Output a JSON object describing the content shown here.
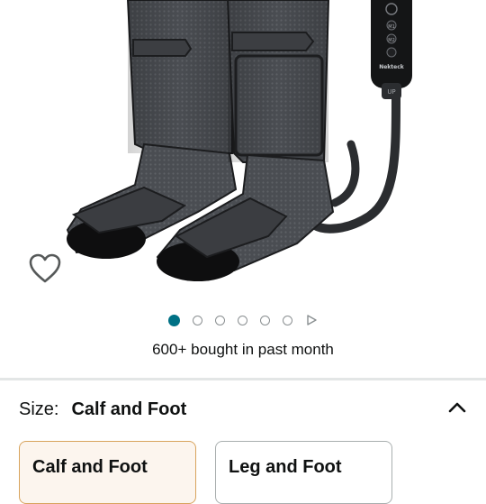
{
  "product": {
    "remote_brand": "Nekteck",
    "remote_up": "UP",
    "remote_buttons": [
      "M1",
      "M2"
    ]
  },
  "carousel": {
    "total_images": 6,
    "active_index": 0,
    "has_video": true
  },
  "social_proof": "600+ bought in past month",
  "size_selector": {
    "label": "Size:",
    "selected_value": "Calf and Foot",
    "options": [
      {
        "label": "Calf and Foot",
        "selected": true
      },
      {
        "label": "Leg and Foot",
        "selected": false
      }
    ]
  },
  "colors": {
    "accent": "#007185",
    "selected_border": "#d8a35c",
    "selected_bg": "#fcf5ee"
  },
  "icons": [
    "heart-outline-icon",
    "play-icon",
    "chevron-up-icon"
  ]
}
